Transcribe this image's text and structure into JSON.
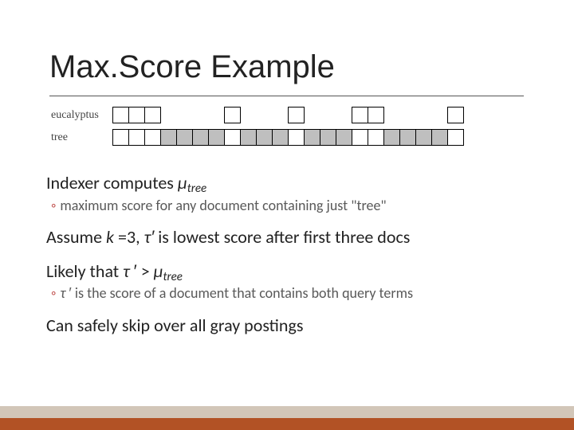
{
  "title": "Max.Score Example",
  "diagram": {
    "rows": [
      {
        "term": "eucalyptus",
        "cells": [
          {
            "t": "box"
          },
          {
            "t": "box"
          },
          {
            "t": "box"
          },
          {
            "t": "sp"
          },
          {
            "t": "sp"
          },
          {
            "t": "sp"
          },
          {
            "t": "sp"
          },
          {
            "t": "box"
          },
          {
            "t": "sp"
          },
          {
            "t": "sp"
          },
          {
            "t": "sp"
          },
          {
            "t": "box"
          },
          {
            "t": "sp"
          },
          {
            "t": "sp"
          },
          {
            "t": "sp"
          },
          {
            "t": "box"
          },
          {
            "t": "box"
          },
          {
            "t": "sp"
          },
          {
            "t": "sp"
          },
          {
            "t": "sp"
          },
          {
            "t": "sp"
          },
          {
            "t": "box"
          }
        ]
      },
      {
        "term": "tree",
        "cells": [
          {
            "t": "box"
          },
          {
            "t": "box"
          },
          {
            "t": "box"
          },
          {
            "t": "gray"
          },
          {
            "t": "gray"
          },
          {
            "t": "gray"
          },
          {
            "t": "gray"
          },
          {
            "t": "box"
          },
          {
            "t": "gray"
          },
          {
            "t": "gray"
          },
          {
            "t": "gray"
          },
          {
            "t": "box"
          },
          {
            "t": "gray"
          },
          {
            "t": "gray"
          },
          {
            "t": "gray"
          },
          {
            "t": "box"
          },
          {
            "t": "box"
          },
          {
            "t": "gray"
          },
          {
            "t": "gray"
          },
          {
            "t": "gray"
          },
          {
            "t": "gray"
          },
          {
            "t": "box"
          }
        ]
      }
    ]
  },
  "body": {
    "l1a": "Indexer computes ",
    "l1b": "μ",
    "l1c": "tree",
    "s1": "maximum score for any document containing just \"tree\"",
    "l2": "Assume k =3, τ′ is lowest score after first three docs",
    "l3a": "Likely that ",
    "l3b": "τ",
    "l3c": " ′ > ",
    "l3d": "μ",
    "l3e": "tree",
    "s2": "τ ′ is the score of a document that contains both query terms",
    "l4": "Can safely skip over all gray postings"
  }
}
